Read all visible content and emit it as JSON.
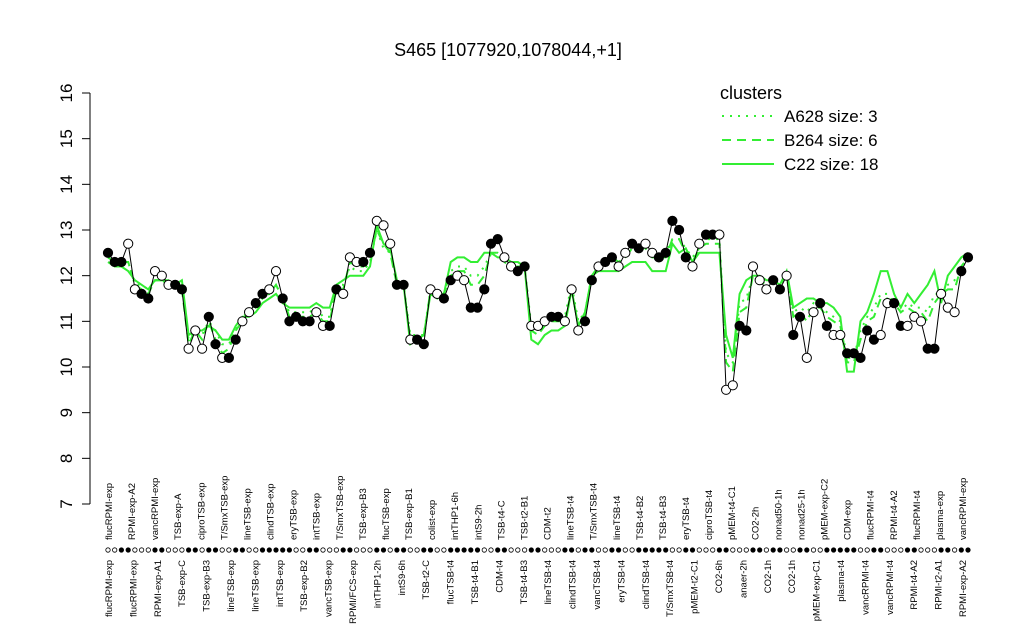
{
  "chart_data": {
    "type": "line",
    "title": "S465 [1077920,1078044,+1]",
    "xlabel": "",
    "ylabel": "",
    "ylim": [
      7,
      16
    ],
    "yticks": [
      7,
      8,
      9,
      10,
      11,
      12,
      13,
      14,
      15,
      16
    ],
    "grid": false,
    "legend": {
      "title": "clusters",
      "placement": "top-right",
      "color": "#33ee33",
      "entries": [
        {
          "name": "A628 size: 3",
          "style": "dotted"
        },
        {
          "name": "B264 size: 6",
          "style": "dashed"
        },
        {
          "name": "C22 size: 18",
          "style": "solid"
        }
      ]
    },
    "top_labels": [
      "flucRPMI-exp",
      "RPMI-exp-A2",
      "vancRPMI-exp",
      "TSB-exp-A",
      "ciproTSB-exp",
      "T/SmxTSB-exp",
      "lineTSB-exp",
      "clindTSB-exp",
      "eryTSB-exp",
      "intTSB-exp",
      "T/SmxTSB-exp",
      "TSB-exp-B3",
      "flucTSB-exp",
      "TSB-exp-B1",
      "colist-exp",
      "intTHP1-6h",
      "intS9-2h",
      "TSB-t4-C",
      "TSB-t2-B1",
      "CDM-t2",
      "lineTSB-t4",
      "T/SmxTSB-t4",
      "lineTSB-t4",
      "TSB-t4-B2",
      "TSB-t4-B3",
      "eryTSB-t4",
      "ciproTSB-t4",
      "pMEM-t4-C1",
      "CO2-2h",
      "nonad50-1h",
      "nonad25-1h",
      "pMEM-exp-C2",
      "CDM-exp",
      "flucRPMI-t4",
      "RPMI-t4-A2",
      "flucRPMI-t4",
      "plasma-exp",
      "vancRPMI-exp"
    ],
    "bottom_labels": [
      "flucRPMI-exp",
      "flucRPMI-exp",
      "RPMI-exp-A1",
      "TSB-exp-C",
      "TSB-exp-B3",
      "lineTSB-exp",
      "lineTSB-exp",
      "intTSB-exp",
      "TSB-exp-B2",
      "vancTSB-exp",
      "RPMI/FCS-exp",
      "intTHP1-2h",
      "intS9-6h",
      "TSB-t2-C",
      "flucTSB-t4",
      "TSB-t4-B1",
      "CDM-t4",
      "TSB-t4-B3",
      "lineTSB-t4",
      "clindTSB-t4",
      "vancTSB-t4",
      "eryTSB-t4",
      "clindTSB-t4",
      "T/SmxTSB-t4",
      "pMEM-t2-C1",
      "CO2-6h",
      "anaer-2h",
      "CO2-1h",
      "CO2-1h",
      "pMEM-exp-C1",
      "plasma-t4",
      "vancRPMI-t4",
      "vancRPMI-t4",
      "RPMI-t4-A2",
      "RPMI-t2-A1",
      "RPMI-exp-A2"
    ],
    "series": [
      {
        "values": [
          12.5,
          12.3,
          12.3,
          12.7,
          11.7,
          11.6,
          11.5,
          12.1,
          12.0,
          11.8,
          11.8,
          11.7,
          10.4,
          10.8,
          10.4,
          11.1,
          10.5,
          10.2,
          10.2,
          10.6,
          11.0,
          11.2,
          11.4,
          11.6,
          11.7,
          12.1,
          11.5,
          11.0,
          11.1,
          11.0,
          11.0,
          11.2,
          10.9,
          10.9,
          11.7,
          11.6,
          12.4,
          12.3,
          12.3,
          12.5,
          13.2,
          13.1,
          12.7,
          11.8,
          11.8,
          10.6,
          10.6,
          10.5,
          11.7,
          11.6,
          11.5,
          11.9,
          12.0,
          11.9,
          11.3,
          11.3,
          11.7,
          12.7,
          12.8,
          12.4,
          12.2,
          12.1,
          12.2,
          10.9,
          10.9,
          11.0,
          11.1,
          11.1,
          11.0,
          11.7,
          10.8,
          11.0,
          11.9,
          12.2,
          12.3,
          12.4,
          12.2,
          12.5,
          12.7,
          12.6,
          12.7,
          12.5,
          12.4,
          12.5,
          13.2,
          13.0,
          12.4,
          12.2,
          12.7,
          12.9,
          12.9,
          12.9,
          9.5,
          9.6,
          10.9,
          10.8,
          12.2,
          11.9,
          11.7,
          11.9,
          11.7,
          12.0,
          10.7,
          11.1,
          10.2,
          11.2,
          11.4,
          10.9,
          10.7,
          10.7,
          10.3,
          10.3,
          10.2,
          10.8,
          10.6,
          10.7,
          11.4,
          11.4,
          10.9,
          10.9,
          11.1,
          11.0,
          10.4,
          10.4,
          11.6,
          11.3,
          11.2,
          12.1,
          12.4
        ]
      },
      {
        "name": "C22 size: 18",
        "values": [
          12.3,
          12.2,
          12.2,
          12.1,
          11.9,
          11.8,
          11.7,
          11.9,
          11.9,
          11.9,
          11.8,
          11.9,
          10.7,
          10.8,
          10.8,
          10.9,
          10.8,
          10.6,
          10.6,
          10.9,
          11.1,
          11.1,
          11.2,
          11.4,
          11.5,
          11.6,
          11.4,
          11.3,
          11.3,
          11.3,
          11.3,
          11.4,
          11.3,
          11.3,
          11.8,
          11.9,
          12.0,
          12.0,
          12.0,
          12.2,
          13.1,
          12.7,
          12.6,
          11.9,
          11.8,
          10.5,
          10.6,
          10.7,
          11.6,
          11.5,
          11.6,
          12.3,
          12.4,
          12.4,
          12.3,
          12.3,
          12.5,
          12.5,
          12.4,
          12.4,
          12.3,
          12.3,
          12.2,
          10.6,
          10.5,
          10.7,
          10.8,
          10.8,
          10.9,
          11.7,
          10.9,
          11.2,
          12.0,
          12.1,
          12.1,
          12.1,
          12.1,
          12.2,
          12.3,
          12.3,
          12.3,
          12.1,
          12.1,
          12.1,
          12.7,
          12.5,
          12.6,
          12.3,
          12.5,
          12.5,
          12.5,
          12.5,
          10.7,
          10.2,
          11.6,
          11.9,
          12.0,
          12.0,
          11.9,
          11.9,
          11.8,
          12.1,
          11.3,
          11.4,
          11.5,
          11.5,
          11.4,
          11.4,
          11.3,
          11.1,
          9.9,
          9.9,
          11.0,
          11.2,
          11.6,
          12.1,
          12.1,
          11.6,
          11.3,
          11.6,
          11.4,
          11.6,
          11.8,
          12.1,
          11.4,
          12.0,
          12.2,
          12.4,
          12.5
        ]
      },
      {
        "name": "B264 size: 6",
        "values": [
          12.4,
          12.3,
          12.3,
          12.3,
          11.8,
          11.7,
          11.6,
          11.9,
          11.9,
          11.8,
          11.8,
          11.7,
          10.5,
          10.8,
          10.6,
          11.0,
          10.6,
          10.3,
          10.4,
          10.8,
          11.0,
          11.2,
          11.3,
          11.6,
          11.6,
          11.8,
          11.5,
          11.1,
          11.1,
          11.1,
          11.1,
          11.2,
          11.0,
          11.0,
          11.7,
          11.7,
          12.3,
          12.2,
          12.2,
          12.4,
          13.0,
          12.7,
          12.5,
          11.8,
          11.8,
          10.6,
          10.6,
          10.6,
          11.7,
          11.6,
          11.6,
          12.0,
          12.1,
          12.1,
          11.8,
          11.8,
          12.0,
          12.5,
          12.5,
          12.3,
          12.2,
          12.2,
          12.2,
          10.8,
          10.7,
          10.9,
          11.0,
          11.0,
          11.0,
          11.7,
          10.9,
          11.1,
          12.0,
          12.2,
          12.3,
          12.4,
          12.3,
          12.4,
          12.6,
          12.6,
          12.6,
          12.4,
          12.4,
          12.4,
          12.8,
          12.8,
          12.5,
          12.3,
          12.6,
          12.7,
          12.7,
          12.7,
          10.1,
          9.9,
          11.2,
          11.3,
          12.0,
          11.9,
          11.8,
          11.9,
          11.8,
          12.0,
          11.1,
          11.2,
          11.0,
          11.3,
          11.3,
          11.1,
          11.0,
          10.9,
          10.1,
          10.1,
          10.6,
          11.0,
          11.1,
          11.5,
          11.5,
          11.4,
          11.2,
          11.3,
          11.2,
          11.2,
          11.0,
          11.4,
          11.6,
          11.7,
          11.7,
          12.2,
          12.4
        ]
      },
      {
        "name": "A628 size: 3",
        "values": [
          12.4,
          12.3,
          12.3,
          12.3,
          11.8,
          11.8,
          11.7,
          11.9,
          11.9,
          11.8,
          11.8,
          11.8,
          10.6,
          10.8,
          10.7,
          11.0,
          10.8,
          10.5,
          10.5,
          10.8,
          11.1,
          11.2,
          11.3,
          11.5,
          11.6,
          11.8,
          11.5,
          11.2,
          11.2,
          11.2,
          11.2,
          11.3,
          11.1,
          11.1,
          11.8,
          11.8,
          12.2,
          12.1,
          12.1,
          12.3,
          13.0,
          12.6,
          12.5,
          11.8,
          11.8,
          10.7,
          10.7,
          10.7,
          11.7,
          11.6,
          11.6,
          12.1,
          12.2,
          12.2,
          12.0,
          12.0,
          12.2,
          12.5,
          12.5,
          12.4,
          12.3,
          12.3,
          12.2,
          10.9,
          10.8,
          11.0,
          11.1,
          11.1,
          11.1,
          11.8,
          11.0,
          11.2,
          12.0,
          12.2,
          12.3,
          12.4,
          12.3,
          12.4,
          12.6,
          12.6,
          12.6,
          12.4,
          12.4,
          12.5,
          12.8,
          12.8,
          12.6,
          12.4,
          12.6,
          12.8,
          12.8,
          12.8,
          10.3,
          10.1,
          11.4,
          11.5,
          12.0,
          11.9,
          11.8,
          11.9,
          11.8,
          12.0,
          11.2,
          11.3,
          11.2,
          11.4,
          11.3,
          11.2,
          11.1,
          11.0,
          10.2,
          10.2,
          10.8,
          11.1,
          11.3,
          11.6,
          11.6,
          11.4,
          11.2,
          11.4,
          11.3,
          11.3,
          11.2,
          11.6,
          11.6,
          11.8,
          11.9,
          12.2,
          12.4
        ]
      }
    ]
  },
  "colors": {
    "observed": "#000000",
    "cluster": "#33ee33"
  }
}
